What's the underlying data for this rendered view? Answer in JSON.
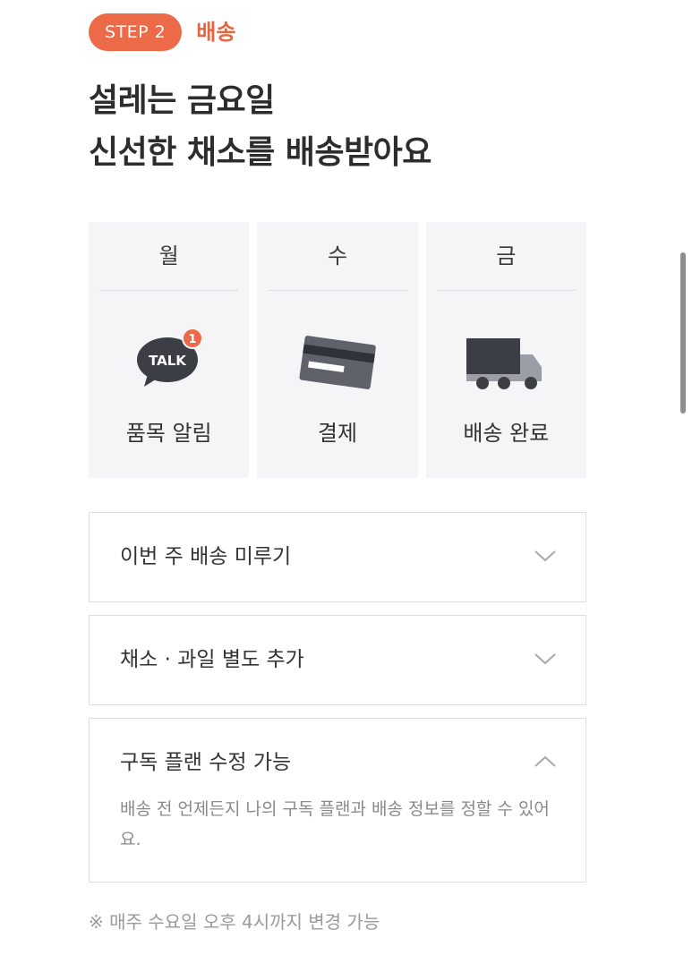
{
  "step": {
    "badge": "STEP 2",
    "label": "배송"
  },
  "headline": {
    "line1": "설레는 금요일",
    "line2": "신선한 채소를 배송받아요"
  },
  "days": [
    {
      "day": "월",
      "label": "품목 알림",
      "icon": "kakaotalk-icon",
      "badge_count": "1",
      "icon_text": "TALK"
    },
    {
      "day": "수",
      "label": "결제",
      "icon": "credit-card-icon"
    },
    {
      "day": "금",
      "label": "배송 완료",
      "icon": "delivery-truck-icon"
    }
  ],
  "accordions": [
    {
      "title": "이번 주 배송 미루기",
      "expanded": false
    },
    {
      "title": "채소 · 과일 별도 추가",
      "expanded": false
    },
    {
      "title": "구독 플랜 수정 가능",
      "expanded": true,
      "body": "배송 전 언제든지 나의 구독 플랜과 배송 정보를 정할 수 있어요."
    }
  ],
  "footnote": "※ 매주 수요일 오후 4시까지 변경 가능",
  "colors": {
    "accent": "#ec6a47",
    "accent_text": "#e8643f",
    "card_bg": "#f5f5f7",
    "icon_dark": "#3b3e45"
  }
}
